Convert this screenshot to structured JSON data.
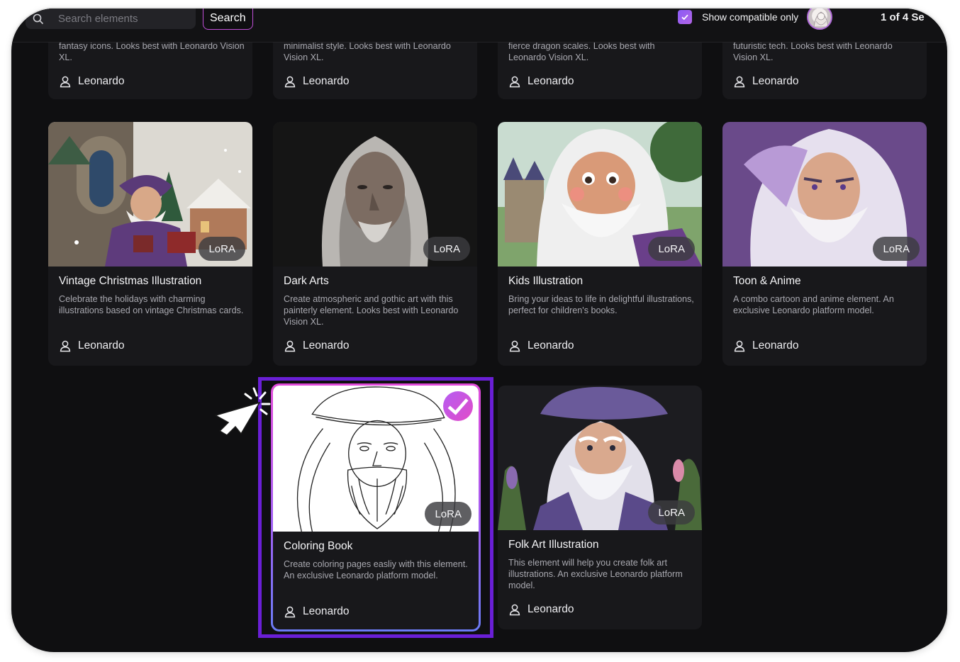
{
  "search": {
    "placeholder": "Search elements",
    "button_label": "Search"
  },
  "filter": {
    "compatible_label": "Show compatible only",
    "checked": true
  },
  "pager": {
    "label": "1 of 4 Se"
  },
  "top_row": [
    {
      "desc": "fantasy icons. Looks best with Leonardo Vision XL.",
      "author": "Leonardo"
    },
    {
      "desc": "minimalist style. Looks best with Leonardo Vision XL.",
      "author": "Leonardo"
    },
    {
      "desc": "fierce dragon scales. Looks best with Leonardo Vision XL.",
      "author": "Leonardo"
    },
    {
      "desc": "futuristic tech. Looks best with Leonardo Vision XL.",
      "author": "Leonardo"
    }
  ],
  "cards": [
    {
      "title": "Vintage Christmas Illustration",
      "desc": "Celebrate the holidays with charming illustrations based on vintage Christmas cards.",
      "badge": "LoRA",
      "author": "Leonardo"
    },
    {
      "title": "Dark Arts",
      "desc": "Create atmospheric and gothic art with this painterly element. Looks best with Leonardo Vision XL.",
      "badge": "LoRA",
      "author": "Leonardo"
    },
    {
      "title": "Kids Illustration",
      "desc": "Bring your ideas to life in delightful illustrations, perfect for children's books.",
      "badge": "LoRA",
      "author": "Leonardo"
    },
    {
      "title": "Toon & Anime",
      "desc": "A combo cartoon and anime element. An exclusive Leonardo platform model.",
      "badge": "LoRA",
      "author": "Leonardo"
    },
    {
      "title": "Coloring Book",
      "desc": "Create coloring pages easliy with this element. An exclusive Leonardo platform model.",
      "badge": "LoRA",
      "author": "Leonardo",
      "selected": true
    },
    {
      "title": "Folk Art Illustration",
      "desc": "This element will help you create folk art illustrations. An exclusive Leonardo platform model.",
      "badge": "LoRA",
      "author": "Leonardo"
    }
  ],
  "colors": {
    "accent": "#6a1fd6",
    "gradient_pink": "#e14ad9",
    "gradient_violet": "#a25ef2"
  },
  "icons": {
    "search": "search-icon",
    "user": "user-icon",
    "check": "check-icon",
    "cursor": "cursor-click-icon"
  }
}
